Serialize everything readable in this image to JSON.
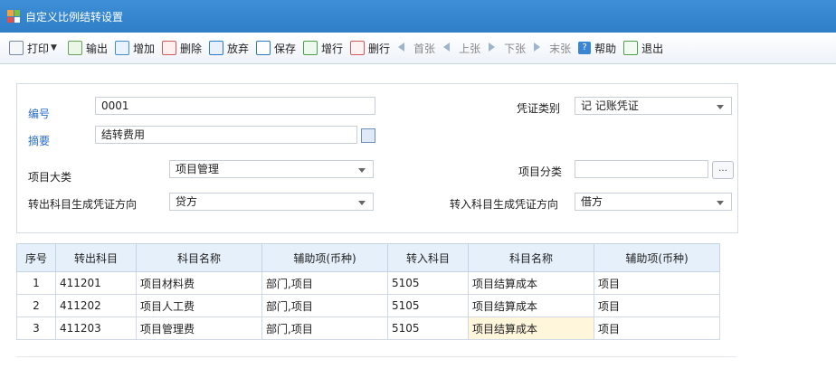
{
  "window": {
    "title": "自定义比例结转设置"
  },
  "toolbar": {
    "print": "打印",
    "export": "输出",
    "add": "增加",
    "delete": "删除",
    "discard": "放弃",
    "save": "保存",
    "insert_row": "增行",
    "delete_row": "删行",
    "first": "首张",
    "prev": "上张",
    "next": "下张",
    "last": "末张",
    "help": "帮助",
    "exit": "退出"
  },
  "form": {
    "number_label": "编号",
    "number_value": "0001",
    "voucher_type_label": "凭证类别",
    "voucher_type_value": "记 记账凭证",
    "summary_label": "摘要",
    "summary_value": "结转费用",
    "project_category_label": "项目大类",
    "project_category_value": "项目管理",
    "project_class_label": "项目分类",
    "project_class_value": "",
    "out_direction_label": "转出科目生成凭证方向",
    "out_direction_value": "贷方",
    "in_direction_label": "转入科目生成凭证方向",
    "in_direction_value": "借方"
  },
  "table": {
    "headers": [
      "序号",
      "转出科目",
      "科目名称",
      "辅助项(币种)",
      "转入科目",
      "科目名称",
      "辅助项(币种)"
    ],
    "rows": [
      [
        "1",
        "411201",
        "项目材料费",
        "部门,项目",
        "5105",
        "项目结算成本",
        "项目"
      ],
      [
        "2",
        "411202",
        "项目人工费",
        "部门,项目",
        "5105",
        "项目结算成本",
        "项目"
      ],
      [
        "3",
        "411203",
        "项目管理费",
        "部门,项目",
        "5105",
        "项目结算成本",
        "项目"
      ]
    ]
  }
}
